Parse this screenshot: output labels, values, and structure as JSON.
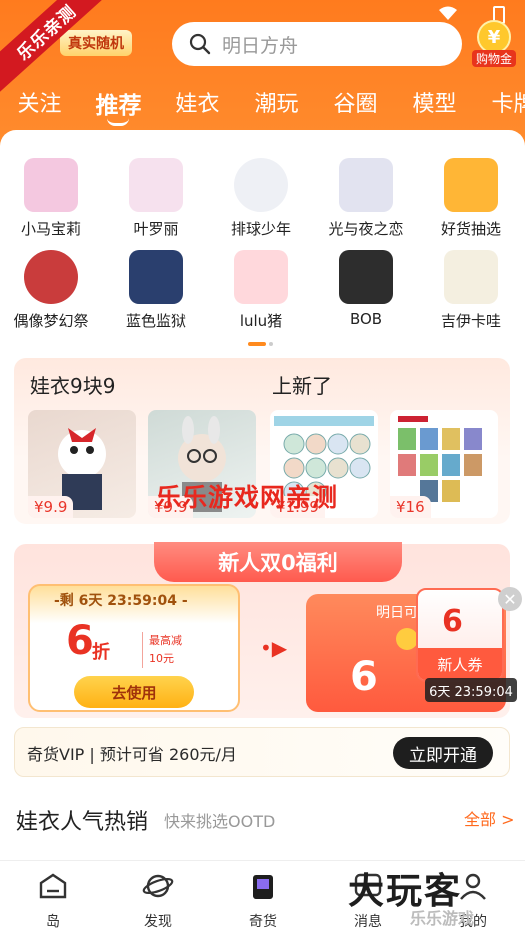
{
  "watermark": {
    "corner_ribbon": "乐乐亲测",
    "center_text": "乐乐游戏网亲测",
    "bottom_logo": "大玩客",
    "bottom_small": "乐乐游戏"
  },
  "header": {
    "brand_pill": "真实随机",
    "search_placeholder": "明日方舟",
    "cart_label": "购物金",
    "cart_coin": "¥"
  },
  "tabs": [
    "关注",
    "推荐",
    "娃衣",
    "潮玩",
    "谷圈",
    "模型",
    "卡牌"
  ],
  "active_tab": "推荐",
  "categories": [
    {
      "label": "小马宝莉",
      "icon": "my-little-pony-icon"
    },
    {
      "label": "叶罗丽",
      "icon": "yeloli-icon"
    },
    {
      "label": "排球少年",
      "icon": "haikyuu-icon"
    },
    {
      "label": "光与夜之恋",
      "icon": "light-and-night-icon"
    },
    {
      "label": "好货抽选",
      "icon": "lottery-wheel-icon"
    },
    {
      "label": "偶像梦幻祭",
      "icon": "ensemble-stars-icon"
    },
    {
      "label": "蓝色监狱",
      "icon": "blue-lock-icon"
    },
    {
      "label": "lulu猪",
      "icon": "lulu-pig-icon"
    },
    {
      "label": "BOB",
      "icon": "bob-icon"
    },
    {
      "label": "吉伊卡哇",
      "icon": "chiikawa-icon"
    }
  ],
  "promo": {
    "left_title": "娃衣9块9",
    "right_title": "上新了",
    "products": [
      {
        "price": "¥9.9"
      },
      {
        "price": "¥9.9"
      },
      {
        "price": "¥1.99"
      },
      {
        "price": "¥16"
      }
    ]
  },
  "new_user": {
    "title": "新人双0福利",
    "countdown": "-剩 6天 23:59:04 -",
    "discount": "6",
    "discount_unit": "折",
    "max_save_label": "最高减",
    "max_save_value": "10元",
    "use_button": "去使用",
    "tomorrow_title": "明日可领",
    "tomorrow_discount": "6",
    "badge_discount": "6",
    "badge_label": "新人券",
    "timer": "6天 23:59:04"
  },
  "vip": {
    "text": "奇货VIP | 预计可省 260元/月",
    "button": "立即开通"
  },
  "hot": {
    "title": "娃衣人气热销",
    "subtitle": "快来挑选OOTD",
    "all": "全部 >"
  },
  "bottom_nav": [
    {
      "label": "岛",
      "icon": "island-icon"
    },
    {
      "label": "发现",
      "icon": "planet-icon"
    },
    {
      "label": "奇货",
      "icon": "shopping-bag-icon"
    },
    {
      "label": "消息",
      "icon": "message-icon"
    },
    {
      "label": "我的",
      "icon": "profile-icon"
    }
  ],
  "colors": {
    "accent": "#ff7b1e",
    "price": "#e9362b",
    "dark_button": "#1e1e1e"
  }
}
